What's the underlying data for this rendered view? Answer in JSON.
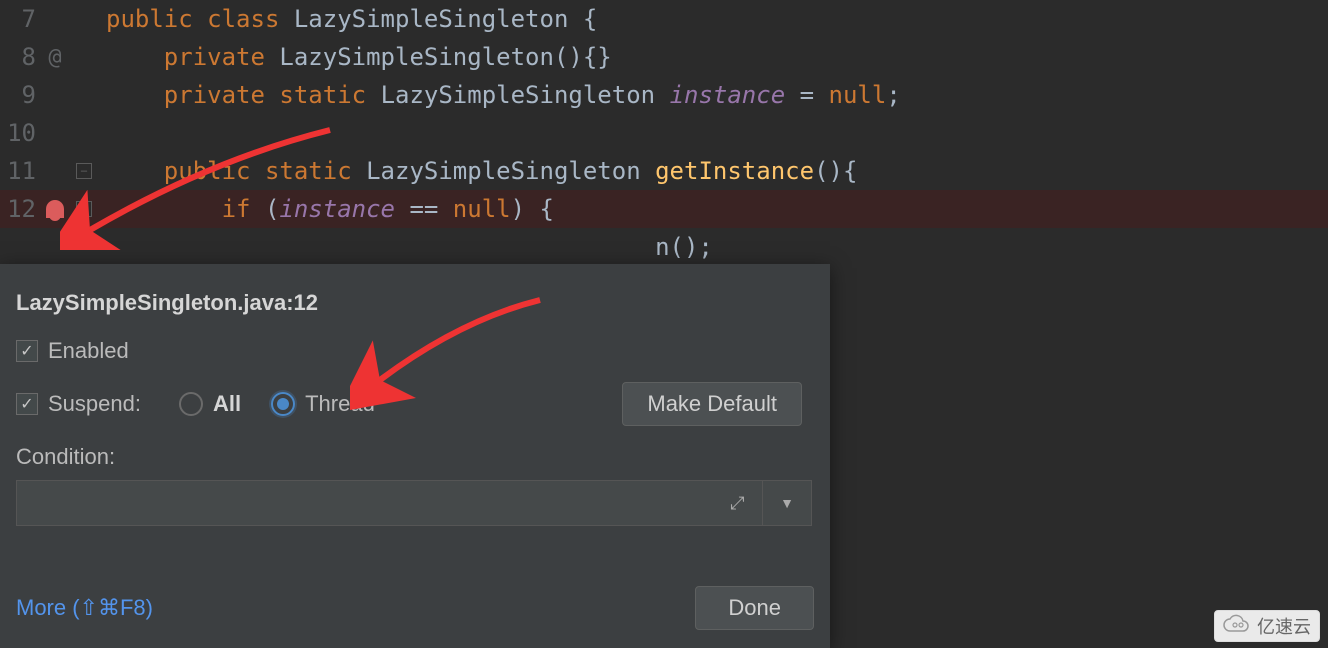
{
  "code": {
    "lines": [
      {
        "num": "7",
        "mark": "",
        "fold": "",
        "bp": false,
        "html": "<span class='kw'>public</span> <span class='kw'>class</span> <span class='cls'>LazySimpleSingleton</span> <span class='brace'>{</span>"
      },
      {
        "num": "8",
        "mark": "@",
        "fold": "",
        "bp": false,
        "html": "    <span class='kw'>private</span> <span class='cls'>LazySimpleSingleton</span>(){}"
      },
      {
        "num": "9",
        "mark": "",
        "fold": "",
        "bp": false,
        "html": "    <span class='kw'>private</span> <span class='kw'>static</span> <span class='cls'>LazySimpleSingleton</span> <span class='fld'>instance</span> = <span class='null'>null</span>;"
      },
      {
        "num": "10",
        "mark": "",
        "fold": "",
        "bp": false,
        "html": ""
      },
      {
        "num": "11",
        "mark": "",
        "fold": "minus",
        "bp": false,
        "html": "    <span class='kw'>public</span> <span class='kw'>static</span> <span class='cls'>LazySimpleSingleton</span> <span class='fn'>getInstance</span>(){"
      },
      {
        "num": "12",
        "mark": "bp",
        "fold": "minus",
        "bp": true,
        "html": "        <span class='kw'>if</span> (<span class='fld'>instance</span> == <span class='null'>null</span>) <span class='brace'>{</span>"
      },
      {
        "num": "",
        "mark": "",
        "fold": "",
        "bp": false,
        "html": "                                      n();"
      }
    ]
  },
  "popup": {
    "title": "LazySimpleSingleton.java:12",
    "enabled_label": "Enabled",
    "enabled_checked": true,
    "suspend_label": "Suspend:",
    "suspend_checked": true,
    "suspend_options": {
      "all": "All",
      "thread": "Thread"
    },
    "suspend_selected": "thread",
    "make_default": "Make Default",
    "condition_label": "Condition:",
    "condition_value": "",
    "more_link": "More (⇧⌘F8)",
    "done": "Done"
  },
  "watermark": {
    "text": "亿速云"
  }
}
